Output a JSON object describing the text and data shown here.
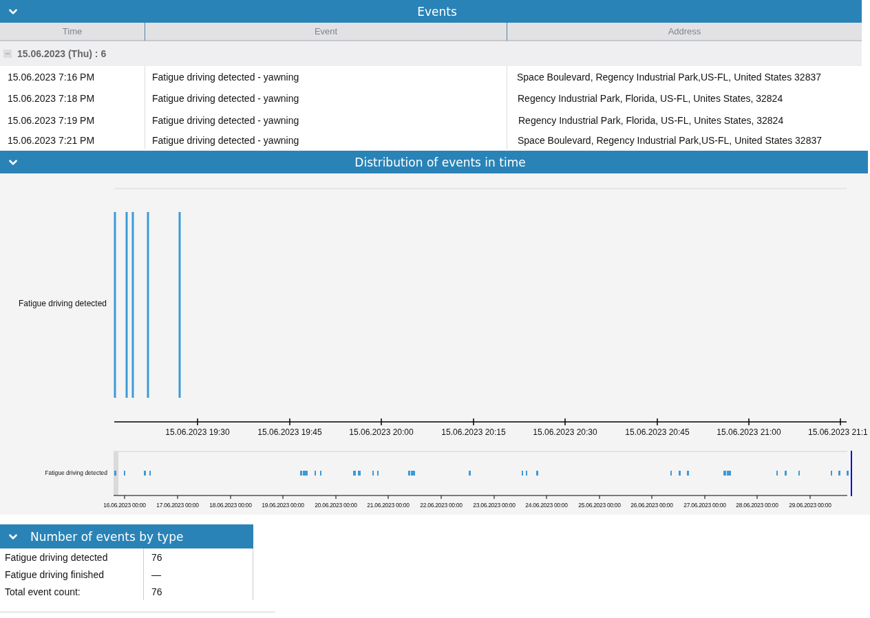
{
  "events_panel": {
    "title": "Events",
    "expanded": true,
    "columns": [
      "Time",
      "Event",
      "Address"
    ],
    "group": {
      "label": "15.06.2023 (Thu) : 6",
      "expanded": true
    },
    "rows": [
      {
        "time": "15.06.2023 7:16 PM",
        "event": "Fatigue driving detected - yawning",
        "address": "Space Boulevard, Regency Industrial Park,US-FL, United States 32837"
      },
      {
        "time": "15.06.2023 7:18 PM",
        "event": "Fatigue driving detected - yawning",
        "address": "Regency Industrial Park, Florida, US-FL, Unites States, 32824"
      },
      {
        "time": "15.06.2023 7:19 PM",
        "event": "Fatigue driving detected - yawning",
        "address": "Regency Industrial Park, Florida, US-FL, Unites States, 32824"
      },
      {
        "time": "15.06.2023 7:21 PM",
        "event": "Fatigue driving detected - yawning",
        "address": "Space Boulevard, Regency Industrial Park,US-FL, United States 32837"
      }
    ]
  },
  "distribution_panel": {
    "title": "Distribution of events in time",
    "expanded": true,
    "row_label": "Fatigue driving detected",
    "time_ticks": [
      "15.06.2023 19:30",
      "15.06.2023 19:45",
      "15.06.2023 20:00",
      "15.06.2023 20:15",
      "15.06.2023 20:30",
      "15.06.2023 20:45",
      "15.06.2023 21:00",
      "15.06.2023 21:1"
    ],
    "overview_label": "Fatigue driving detected",
    "overview_ticks": [
      "16.06.2023 00:00",
      "17.06.2023 00:00",
      "18.06.2023 00:00",
      "19.06.2023 00:00",
      "20.06.2023 00:00",
      "21.06.2023 00:00",
      "22.06.2023 00:00",
      "23.06.2023 00:00",
      "24.06.2023 00:00",
      "25.06.2023 00:00",
      "26.06.2023 00:00",
      "27.06.2023 00:00",
      "28.06.2023 00:00",
      "29.06.2023 00:00"
    ]
  },
  "summary_panel": {
    "title": "Number of events by type",
    "expanded": true,
    "rows": [
      {
        "label": "Fatigue driving detected",
        "value": "76"
      },
      {
        "label": "Fatigue driving finished",
        "value": "—"
      },
      {
        "label": "Total event count:",
        "value": "76"
      }
    ]
  }
}
